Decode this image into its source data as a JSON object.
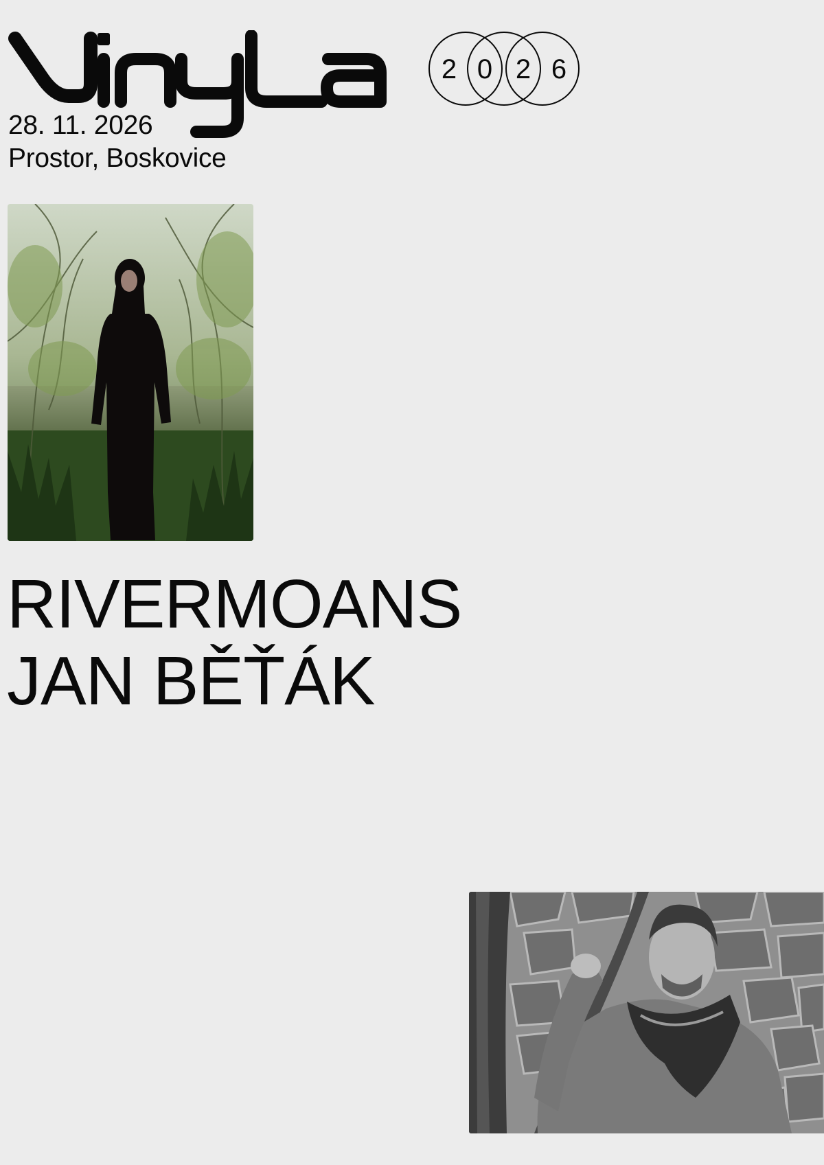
{
  "header": {
    "logo_wordmark": "Vinyla",
    "year_digits": [
      "2",
      "0",
      "2",
      "6"
    ]
  },
  "event": {
    "date": "28. 11. 2026",
    "venue": "Prostor, Boskovice"
  },
  "artists": [
    {
      "name": "RIVERMOANS"
    },
    {
      "name": "JAN BĚŤÁK"
    }
  ],
  "photos": {
    "photo_1": {
      "style": "color",
      "subject": "person in long black dress among willow branches by a river"
    },
    "photo_2": {
      "style": "black-and-white",
      "subject": "man with scarf holding tree branch in front of stone wall"
    }
  },
  "colors": {
    "background": "#ececec",
    "ink": "#0a0a0a"
  }
}
